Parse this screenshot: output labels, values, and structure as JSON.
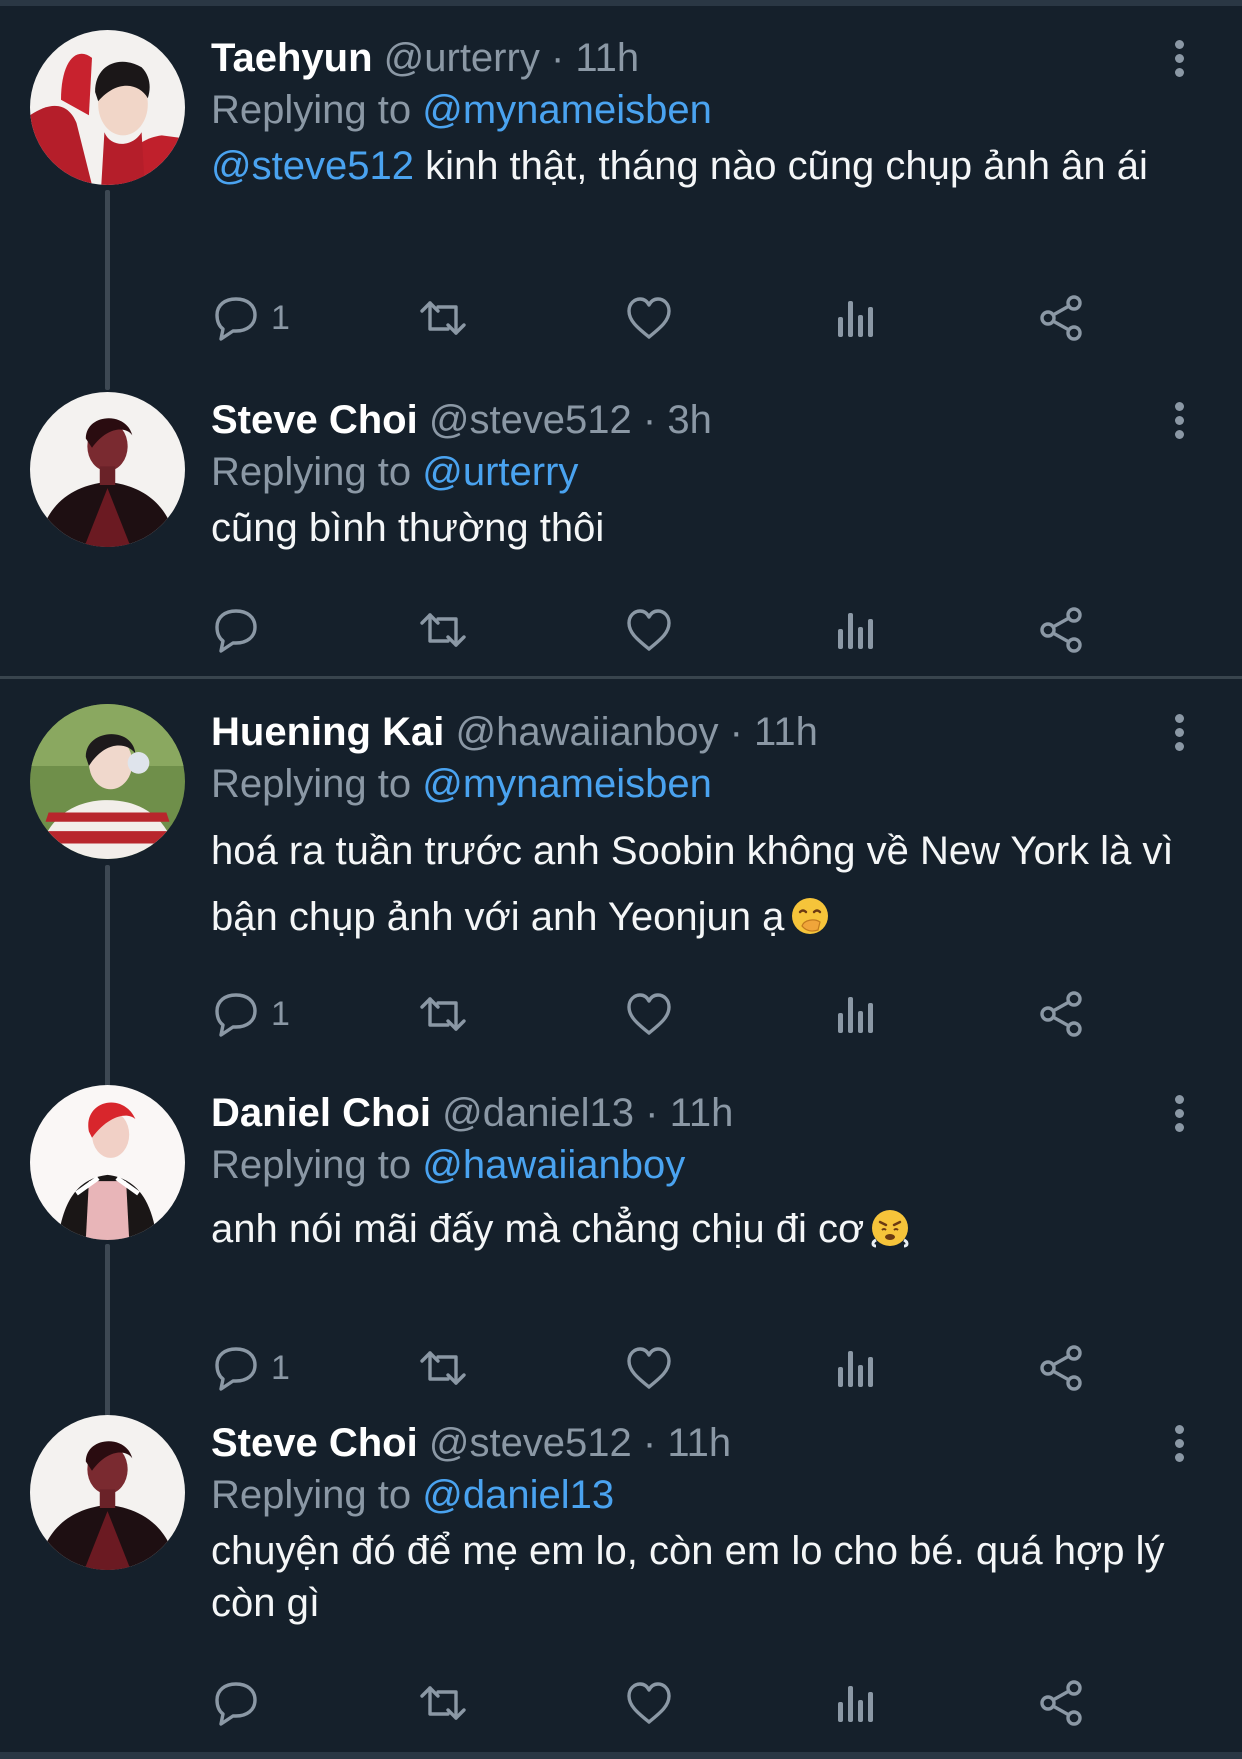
{
  "tweets": [
    {
      "name": "Taehyun",
      "handle": "@urterry",
      "dot": "·",
      "time": "11h",
      "replying_label": "Replying to",
      "replying_to": "@mynameisben",
      "mention": "@steve512",
      "text": " kinh thật, tháng nào cũng chụp ảnh ân ái",
      "reply_count": "1",
      "avatar_icon": "avatar-photo-red"
    },
    {
      "name": "Steve Choi",
      "handle": "@steve512",
      "dot": "·",
      "time": "3h",
      "replying_label": "Replying to",
      "replying_to": "@urterry",
      "text": "cũng bình thường thôi",
      "reply_count": "",
      "avatar_icon": "avatar-photo-dark"
    },
    {
      "name": "Huening Kai",
      "handle": "@hawaiianboy",
      "dot": "·",
      "time": "11h",
      "replying_label": "Replying to",
      "replying_to": "@mynameisben",
      "text": "hoá ra tuần trước anh Soobin không về New York là vì bận chụp ảnh với anh Yeonjun ạ",
      "emoji": "hand-over-mouth-emoji",
      "reply_count": "1",
      "avatar_icon": "avatar-photo-green"
    },
    {
      "name": "Daniel Choi",
      "handle": "@daniel13",
      "dot": "·",
      "time": "11h",
      "replying_label": "Replying to",
      "replying_to": "@hawaiianboy",
      "text": "anh nói mãi đấy mà chẳng chịu đi cơ",
      "emoji": "huffing-face-emoji",
      "reply_count": "1",
      "avatar_icon": "avatar-photo-white"
    },
    {
      "name": "Steve Choi",
      "handle": "@steve512",
      "dot": "·",
      "time": "11h",
      "replying_label": "Replying to",
      "replying_to": "@daniel13",
      "text": "chuyện đó để mẹ em lo, còn em lo cho bé. quá hợp lý còn gì",
      "reply_count": "",
      "avatar_icon": "avatar-photo-dark"
    }
  ],
  "action_icons": [
    "reply-icon",
    "retweet-icon",
    "like-icon",
    "analytics-icon",
    "share-icon"
  ],
  "colors": {
    "background": "#15202b",
    "muted": "#8b98a5",
    "link": "#4aa3f0",
    "separator": "#38444d"
  }
}
